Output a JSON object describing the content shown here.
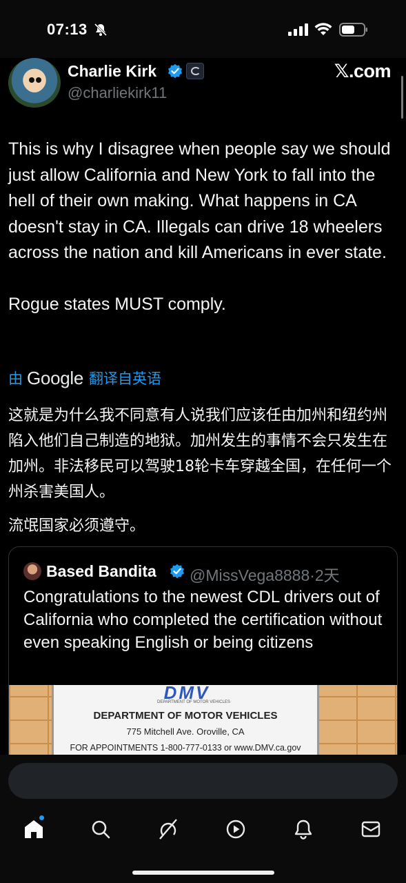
{
  "status_bar": {
    "time": "07:13",
    "icons": [
      "bell-slash-icon",
      "signal-icon",
      "wifi-icon",
      "battery-icon"
    ]
  },
  "header": {
    "display_name": "Charlie Kirk",
    "handle": "@charliekirk11",
    "site_logo": "𝕏.com"
  },
  "tweet": {
    "text": "This is why I disagree when people say we should just allow California and New York to fall into the hell of their own making. What happens in CA doesn't stay in CA. Illegals can drive 18 wheelers across the nation and kill Americans in ever state.\n\nRogue states MUST comply."
  },
  "translation": {
    "prefix": "由",
    "provider": "Google",
    "suffix": "翻译自英语",
    "paragraphs": [
      "这就是为什么我不同意有人说我们应该任由加州和纽约州陷入他们自己制造的地狱。加州发生的事情不会只发生在加州。非法移民可以驾驶18轮卡车穿越全国，在任何一个州杀害美国人。",
      "流氓国家必须遵守。"
    ]
  },
  "quote": {
    "display_name": "Based Bandita",
    "handle_time": "@MissVega8888·2天",
    "text": "Congratulations to the newest CDL drivers out of California who completed the certification without even speaking English or being citizens",
    "image": {
      "logo": "DMV",
      "logo_sub": "DEPARTMENT OF MOTOR VEHICLES",
      "department": "DEPARTMENT OF MOTOR VEHICLES",
      "address": "775 Mitchell Ave.  Oroville, CA",
      "phone": "FOR APPOINTMENTS 1-800-777-0133  or  www.DMV.ca.gov"
    }
  },
  "reply": {
    "placeholder": ""
  },
  "bottom_nav": [
    "home-icon",
    "search-icon",
    "grok-icon",
    "video-icon",
    "notifications-icon",
    "messages-icon"
  ],
  "colors": {
    "accent": "#1d9bf0",
    "background": "#000000",
    "text": "#e7e9ea",
    "secondary_text": "#71767b"
  }
}
